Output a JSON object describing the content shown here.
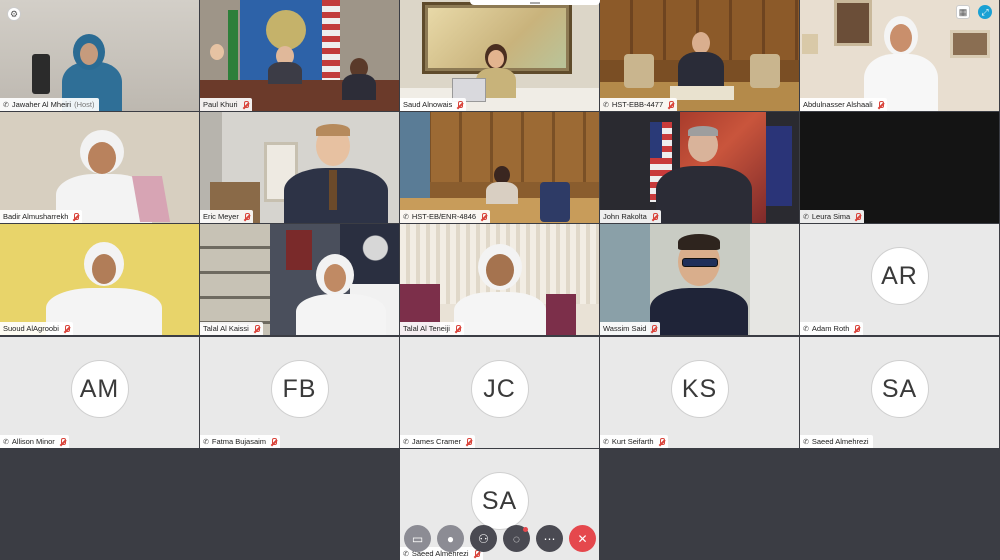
{
  "participants": [
    {
      "name": "Jawaher Al Mheiri",
      "suffix": "(Host)",
      "phone": true,
      "muted": false
    },
    {
      "name": "Paul Khuri",
      "muted": true
    },
    {
      "name": "Saud Alnowais",
      "muted": true
    },
    {
      "name": "HST-EBB-4477",
      "muted": true,
      "phone": true
    },
    {
      "name": "Abdulnasser Alshaali",
      "muted": true
    },
    {
      "name": "Badir Almusharrekh",
      "muted": true
    },
    {
      "name": "Eric Meyer",
      "muted": true
    },
    {
      "name": "HST-EB/ENR-4846",
      "muted": true,
      "phone": true
    },
    {
      "name": "John Rakolta",
      "muted": true
    },
    {
      "name": "Leura Sima",
      "muted": true,
      "phone": true
    },
    {
      "name": "Suoud AlAgroobi",
      "muted": true
    },
    {
      "name": "Talal Al Kaissi",
      "muted": true
    },
    {
      "name": "Talal Al Teneiji",
      "muted": true
    },
    {
      "name": "Wassim Said",
      "muted": true
    },
    {
      "name": "Adam Roth",
      "initials": "AR",
      "muted": true,
      "phone": true
    },
    {
      "name": "Allison Minor",
      "initials": "AM",
      "muted": true,
      "phone": true
    },
    {
      "name": "Fatma Bujasaim",
      "initials": "FB",
      "muted": true,
      "phone": true
    },
    {
      "name": "James Cramer",
      "initials": "JC",
      "muted": true,
      "phone": true
    },
    {
      "name": "Kurt Seifarth",
      "initials": "KS",
      "muted": true,
      "phone": true
    },
    {
      "name": "Saeed Almehrezi",
      "initials": "SA",
      "muted": false,
      "phone": true
    },
    {
      "name": "Saeed Almehrezi",
      "initials": "SA",
      "muted": true,
      "phone": true
    }
  ],
  "controls": [
    {
      "icon": "video-icon",
      "color": "#8c8c94"
    },
    {
      "icon": "microphone-icon",
      "color": "#8c8c94"
    },
    {
      "icon": "participants-icon",
      "color": "#4a4a52"
    },
    {
      "icon": "chat-icon",
      "color": "#4a4a52"
    },
    {
      "icon": "more-icon",
      "color": "#4a4a52"
    },
    {
      "icon": "end-call-icon",
      "color": "#e5484d"
    }
  ],
  "colors": {
    "active_border": "#39c0e8",
    "end_call": "#e5484d",
    "muted_mic": "#d9443b"
  }
}
